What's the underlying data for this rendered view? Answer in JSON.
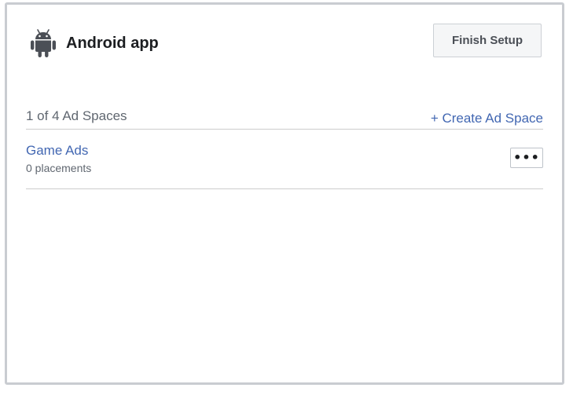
{
  "app": {
    "platform_icon": "android-icon",
    "title": "Android app",
    "finish_button_label": "Finish Setup"
  },
  "ad_spaces": {
    "count_label": "1 of 4 Ad Spaces",
    "create_label": "+ Create Ad Space",
    "items": [
      {
        "name": "Game Ads",
        "placements": "0 placements",
        "more_icon": "more-horizontal-icon",
        "more_label": "•••"
      }
    ]
  },
  "colors": {
    "link": "#4267b2",
    "title": "#1c1e21",
    "secondary_text": "#606770",
    "icon": "#4b4f56",
    "border": "#c9ccd1"
  }
}
